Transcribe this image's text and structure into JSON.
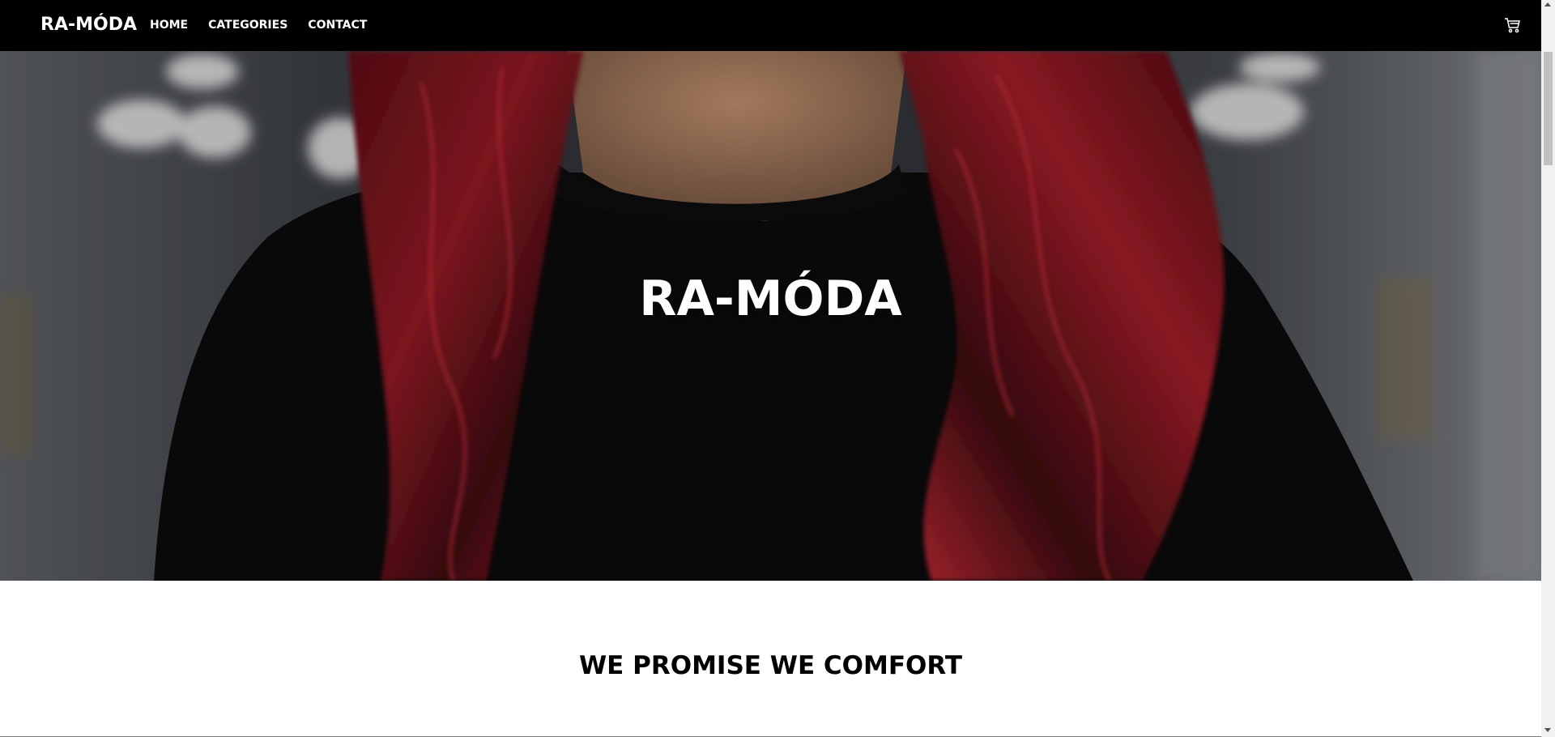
{
  "navbar": {
    "brand": "RA-MÓDA",
    "links": [
      "HOME",
      "CATEGORIES",
      "CONTACT"
    ],
    "cart_icon": "cart-icon"
  },
  "hero": {
    "title": "RA-MÓDA",
    "image": "woman-red-hair-black-tshirt-photo"
  },
  "section": {
    "title": "WE PROMISE WE COMFORT"
  },
  "colors": {
    "navbar_bg": "#000000",
    "text_light": "#ffffff",
    "text_dark": "#000000"
  }
}
